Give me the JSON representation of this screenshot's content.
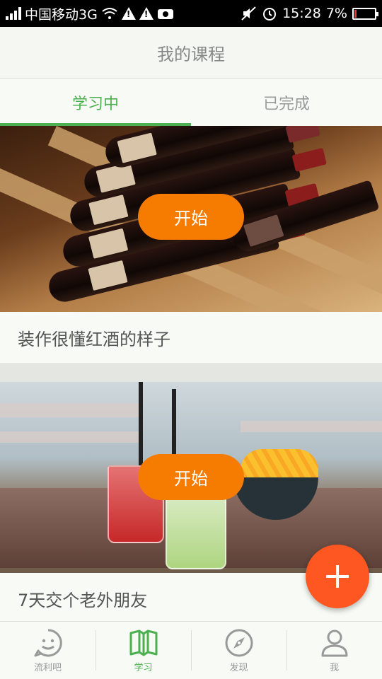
{
  "status_bar": {
    "carrier": "中国移动3G",
    "time": "15:28",
    "battery": "7%"
  },
  "header": {
    "title": "我的课程"
  },
  "tabs": [
    {
      "label": "学习中",
      "active": true
    },
    {
      "label": "已完成",
      "active": false
    }
  ],
  "courses": [
    {
      "title": "装作很懂红酒的样子",
      "button_label": "开始"
    },
    {
      "title": "7天交个老外朋友",
      "button_label": "开始"
    }
  ],
  "fab": {
    "icon": "plus-icon"
  },
  "bottom_nav": [
    {
      "label": "流利吧",
      "icon": "smiley-face-icon",
      "active": false
    },
    {
      "label": "学习",
      "icon": "open-book-icon",
      "active": true
    },
    {
      "label": "发现",
      "icon": "compass-icon",
      "active": false
    },
    {
      "label": "我",
      "icon": "user-icon",
      "active": false
    }
  ],
  "colors": {
    "accent_green": "#4caf50",
    "start_button": "#f57c00",
    "fab": "#ff5722"
  }
}
